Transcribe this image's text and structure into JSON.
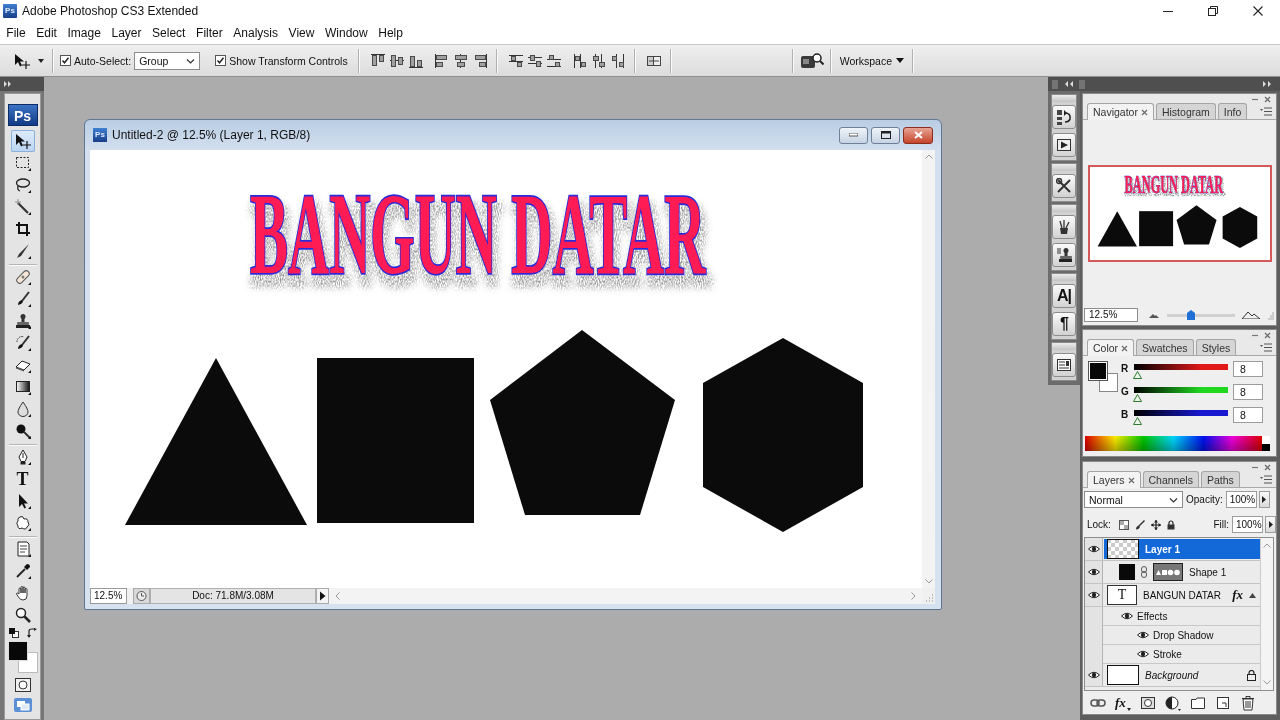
{
  "app": {
    "logo": "Ps",
    "title": "Adobe Photoshop CS3 Extended"
  },
  "menu": [
    "File",
    "Edit",
    "Image",
    "Layer",
    "Select",
    "Filter",
    "Analysis",
    "View",
    "Window",
    "Help"
  ],
  "options_bar": {
    "auto_select": {
      "label": "Auto-Select:",
      "checked": true
    },
    "auto_select_target": "Group",
    "transform_controls": {
      "label": "Show Transform Controls",
      "checked": true
    },
    "workspace": "Workspace"
  },
  "toolbox": {
    "logo": "Ps",
    "groups": [
      {
        "tools": [
          {
            "kind": "move",
            "selected": true
          },
          {
            "kind": "marquee",
            "selected": false
          },
          {
            "kind": "lasso",
            "selected": false
          },
          {
            "kind": "wand",
            "selected": false
          },
          {
            "kind": "crop",
            "selected": false
          },
          {
            "kind": "slice",
            "selected": false
          }
        ]
      },
      {
        "tools": [
          {
            "kind": "heal",
            "selected": false
          },
          {
            "kind": "brush",
            "selected": false
          },
          {
            "kind": "stamp",
            "selected": false
          },
          {
            "kind": "history",
            "selected": false
          },
          {
            "kind": "eraser",
            "selected": false
          },
          {
            "kind": "gradient",
            "selected": false
          },
          {
            "kind": "blur",
            "selected": false
          },
          {
            "kind": "dodge",
            "selected": false
          }
        ]
      },
      {
        "tools": [
          {
            "kind": "pen",
            "selected": false
          },
          {
            "kind": "type",
            "glyph": "T",
            "selected": false
          },
          {
            "kind": "path",
            "selected": false
          },
          {
            "kind": "shape",
            "selected": false
          }
        ]
      },
      {
        "tools": [
          {
            "kind": "notes",
            "selected": false
          },
          {
            "kind": "eyedropper",
            "selected": false
          },
          {
            "kind": "hand",
            "selected": false
          },
          {
            "kind": "zoom",
            "selected": false
          }
        ]
      }
    ]
  },
  "document": {
    "logo": "Ps",
    "title": "Untitled-2 @ 12.5% (Layer 1, RGB/8)",
    "canvas_text": "BANGUN DATAR",
    "zoom": "12.5%",
    "info": "Doc: 71.8M/3.08M"
  },
  "panel_dock": {
    "groups": [
      {
        "icons": [
          {
            "kind": "comps"
          },
          {
            "kind": "actions"
          }
        ]
      },
      {
        "icons": [
          {
            "kind": "tools"
          }
        ]
      },
      {
        "icons": [
          {
            "kind": "presets"
          },
          {
            "kind": "clone"
          }
        ]
      },
      {
        "icons": [
          {
            "kind": "glyph",
            "glyph": "A|"
          },
          {
            "kind": "glyph",
            "glyph": "¶"
          }
        ]
      },
      {
        "icons": [
          {
            "kind": "notes"
          }
        ]
      }
    ]
  },
  "navigator_panel": {
    "tabs": [
      {
        "label": "Navigator",
        "selected": true
      },
      {
        "label": "Histogram",
        "selected": false
      },
      {
        "label": "Info",
        "selected": false
      }
    ],
    "preview_text": "BANGUN DATAR",
    "zoom": "12.5%",
    "zoom_slider": {
      "level": 0.35
    }
  },
  "color_panel": {
    "tabs": [
      {
        "label": "Color",
        "selected": true
      },
      {
        "label": "Swatches",
        "selected": false
      },
      {
        "label": "Styles",
        "selected": false
      }
    ],
    "channels": [
      {
        "name": "R",
        "color": "#e01818",
        "level": 0.03,
        "value": "8"
      },
      {
        "name": "G",
        "color": "#20d820",
        "level": 0.03,
        "value": "8"
      },
      {
        "name": "B",
        "color": "#1818d0",
        "level": 0.03,
        "value": "8"
      }
    ]
  },
  "layers_panel": {
    "tabs": [
      {
        "label": "Layers",
        "selected": true
      },
      {
        "label": "Channels",
        "selected": false
      },
      {
        "label": "Paths",
        "selected": false
      }
    ],
    "blend_mode": "Normal",
    "opacity_label": "Opacity:",
    "opacity": "100%",
    "lock_label": "Lock:",
    "fill_label": "Fill:",
    "fill": "100%",
    "layers": [
      {
        "name": "Layer 1",
        "kind": "pixel",
        "visible": true,
        "selected": true,
        "locked": false
      },
      {
        "name": "Shape 1",
        "kind": "shape",
        "visible": true,
        "selected": false,
        "locked": false
      },
      {
        "name": "BANGUN DATAR",
        "kind": "text",
        "thumb": "T",
        "style_badge": "fx",
        "visible": true,
        "selected": false,
        "locked": false,
        "expanded": true,
        "children": [
          {
            "name": "Effects",
            "visible": true,
            "children": [
              {
                "name": "Drop Shadow",
                "visible": true
              },
              {
                "name": "Stroke",
                "visible": true
              }
            ]
          }
        ]
      },
      {
        "name": "Background",
        "kind": "background",
        "visible": true,
        "selected": false,
        "locked": true
      }
    ],
    "footer": [
      {
        "kind": "link"
      },
      {
        "kind": "fx",
        "label": "fx"
      },
      {
        "kind": "mask"
      },
      {
        "kind": "adjustment"
      },
      {
        "kind": "folder"
      },
      {
        "kind": "new"
      },
      {
        "kind": "trash"
      }
    ]
  }
}
